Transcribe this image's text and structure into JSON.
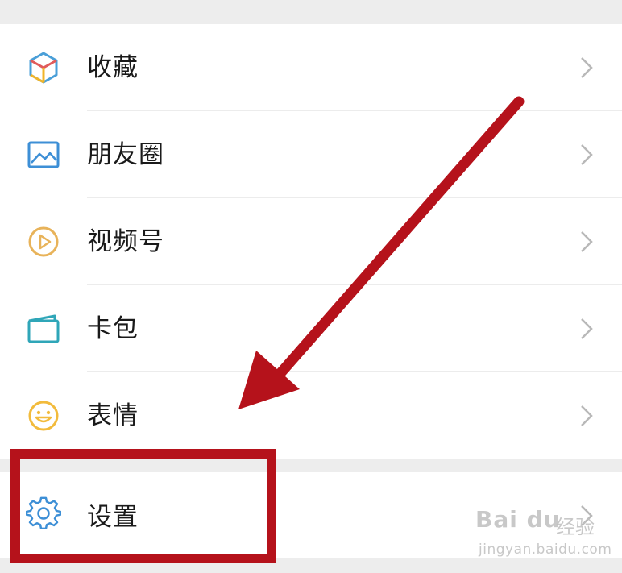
{
  "menu": {
    "items": [
      {
        "label": "收藏",
        "icon": "favorites-cube-icon"
      },
      {
        "label": "朋友圈",
        "icon": "moments-image-icon"
      },
      {
        "label": "视频号",
        "icon": "channels-play-icon"
      },
      {
        "label": "卡包",
        "icon": "card-wallet-icon"
      },
      {
        "label": "表情",
        "icon": "sticker-smile-icon"
      }
    ],
    "settings": {
      "label": "设置",
      "icon": "gear-icon"
    }
  },
  "annotation": {
    "arrow_color": "#b5121b",
    "box_color": "#b5121b"
  },
  "watermark": {
    "logo": "Bai du",
    "text": "经验",
    "url": "jingyan.baidu.com"
  }
}
